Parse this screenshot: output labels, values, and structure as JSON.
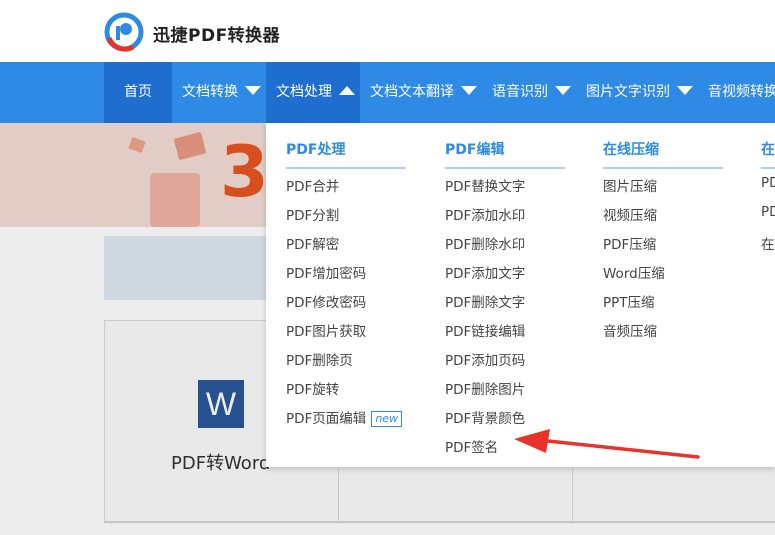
{
  "header": {
    "site_name": "迅捷PDF转换器",
    "logo_icon": "xunjie-logo-icon"
  },
  "nav": {
    "items": [
      {
        "label": "首页",
        "dropdown": false
      },
      {
        "label": "文档转换",
        "dropdown": true
      },
      {
        "label": "文档处理",
        "dropdown": true,
        "active": true
      },
      {
        "label": "文档文本翻译",
        "dropdown": true
      },
      {
        "label": "语音识别",
        "dropdown": true
      },
      {
        "label": "图片文字识别",
        "dropdown": true
      },
      {
        "label": "音视频转换",
        "dropdown": true
      }
    ]
  },
  "background": {
    "card_label": "PDF转Word",
    "word_icon_letter": "W",
    "banner_text": "3"
  },
  "dropdown": {
    "columns": [
      {
        "title": "PDF处理",
        "items": [
          "PDF合并",
          "PDF分割",
          "PDF解密",
          "PDF增加密码",
          "PDF修改密码",
          "PDF图片获取",
          "PDF删除页",
          "PDF旋转",
          "PDF页面编辑"
        ],
        "new_badge_item": "PDF页面编辑",
        "new_badge_text": "new"
      },
      {
        "title": "PDF编辑",
        "items": [
          "PDF替换文字",
          "PDF添加水印",
          "PDF删除水印",
          "PDF添加文字",
          "PDF删除文字",
          "PDF链接编辑",
          "PDF添加页码",
          "PDF删除图片",
          "PDF背景颜色",
          "PDF签名"
        ]
      },
      {
        "title": "在线压缩",
        "items": [
          "图片压缩",
          "视频压缩",
          "PDF压缩",
          "Word压缩",
          "PPT压缩",
          "音频压缩"
        ]
      },
      {
        "title": "在",
        "items": [
          "PD",
          "PD",
          "在"
        ]
      }
    ]
  },
  "colors": {
    "nav_bg": "#2f8ae5",
    "nav_active": "#1f6ecf",
    "accent": "#2f8ae5",
    "annotation_arrow": "#e8332a"
  }
}
